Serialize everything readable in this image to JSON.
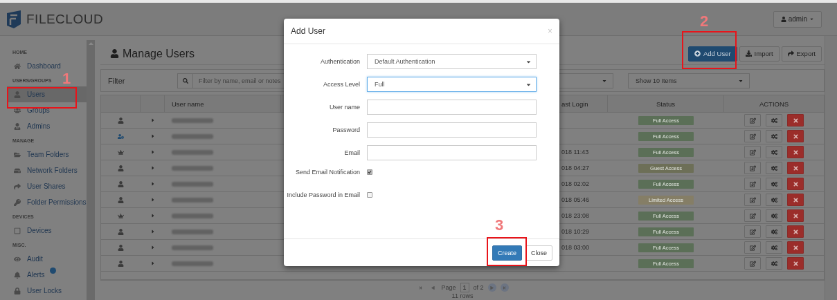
{
  "header": {
    "logo_text": "FILECLOUD",
    "user_menu": "admin"
  },
  "sidebar": {
    "sections": [
      {
        "heading": "HOME",
        "items": [
          {
            "label": "Dashboard",
            "selected": false
          }
        ]
      },
      {
        "heading": "USERS/GROUPS",
        "items": [
          {
            "label": "Users",
            "selected": true
          },
          {
            "label": "Groups",
            "selected": false
          },
          {
            "label": "Admins",
            "selected": false
          }
        ]
      },
      {
        "heading": "MANAGE",
        "items": [
          {
            "label": "Team Folders",
            "selected": false
          },
          {
            "label": "Network Folders",
            "selected": false
          },
          {
            "label": "User Shares",
            "selected": false
          },
          {
            "label": "Folder Permissions",
            "selected": false
          }
        ]
      },
      {
        "heading": "DEVICES",
        "items": [
          {
            "label": "Devices",
            "selected": false
          }
        ]
      },
      {
        "heading": "MISC.",
        "items": [
          {
            "label": "Audit",
            "selected": false
          },
          {
            "label": "Alerts",
            "selected": false,
            "notification": true
          },
          {
            "label": "User Locks",
            "selected": false
          }
        ]
      }
    ]
  },
  "page": {
    "title": "Manage Users",
    "buttons": [
      {
        "label": "Add User",
        "kind": "primary"
      },
      {
        "label": "Import",
        "kind": "import"
      },
      {
        "label": "Export",
        "kind": "export"
      }
    ]
  },
  "filter": {
    "label": "Filter",
    "placeholder": "Filter by name, email or notes",
    "page_size": "Show 10 Items"
  },
  "table": {
    "columns": [
      {
        "label": "User name"
      },
      {
        "label": "ast Login"
      },
      {
        "label": "Status"
      },
      {
        "label": "ACTIONS"
      }
    ],
    "rows": [
      {
        "kind": "person",
        "status": "Full Access",
        "color": "#5b6f57"
      },
      {
        "kind": "keyholder",
        "status": "Full Access",
        "color": "#5b6f57"
      },
      {
        "kind": "crown",
        "last_login": "018 11:43",
        "status": "Full Access",
        "color": "#5b6f57"
      },
      {
        "kind": "person",
        "last_login": "018 04:27",
        "status": "Guest Access",
        "color": "#6d6f57"
      },
      {
        "kind": "person",
        "last_login": "018 02:02",
        "status": "Full Access",
        "color": "#5b6f57"
      },
      {
        "kind": "person",
        "last_login": "018 05:46",
        "status": "Limited Access",
        "color": "#857e66"
      },
      {
        "kind": "crown",
        "last_login": "018 23:08",
        "status": "Full Access",
        "color": "#5b6f57"
      },
      {
        "kind": "person",
        "last_login": "018 10:29",
        "status": "Full Access",
        "color": "#5b6f57"
      },
      {
        "kind": "person",
        "last_login": "018 03:00",
        "status": "Full Access",
        "color": "#5b6f57"
      },
      {
        "kind": "person",
        "status": "Full Access",
        "color": "#5b6f57"
      }
    ]
  },
  "pagination": {
    "page_label": "Page",
    "page": "1",
    "of": "of 2",
    "count": "11 rows"
  },
  "dialog": {
    "title": "Add User",
    "close": "×",
    "fields": [
      {
        "kind": "select",
        "label": "Authentication",
        "value": "Default Authentication",
        "focused": false
      },
      {
        "kind": "select",
        "label": "Access Level",
        "value": "Full",
        "focused": true
      },
      {
        "kind": "text",
        "label": "User name"
      },
      {
        "kind": "text",
        "label": "Password"
      },
      {
        "kind": "text",
        "label": "Email"
      },
      {
        "kind": "checkbox",
        "label": "Send Email Notification",
        "checked": true
      },
      {
        "kind": "checkbox",
        "label": "Include Password in Email",
        "checked": false
      }
    ],
    "buttons": [
      {
        "label": "Create",
        "kind": "primary"
      },
      {
        "label": "Close",
        "kind": "default"
      }
    ]
  },
  "annotations": [
    {
      "number": "1"
    },
    {
      "number": "2"
    },
    {
      "number": "3"
    }
  ]
}
